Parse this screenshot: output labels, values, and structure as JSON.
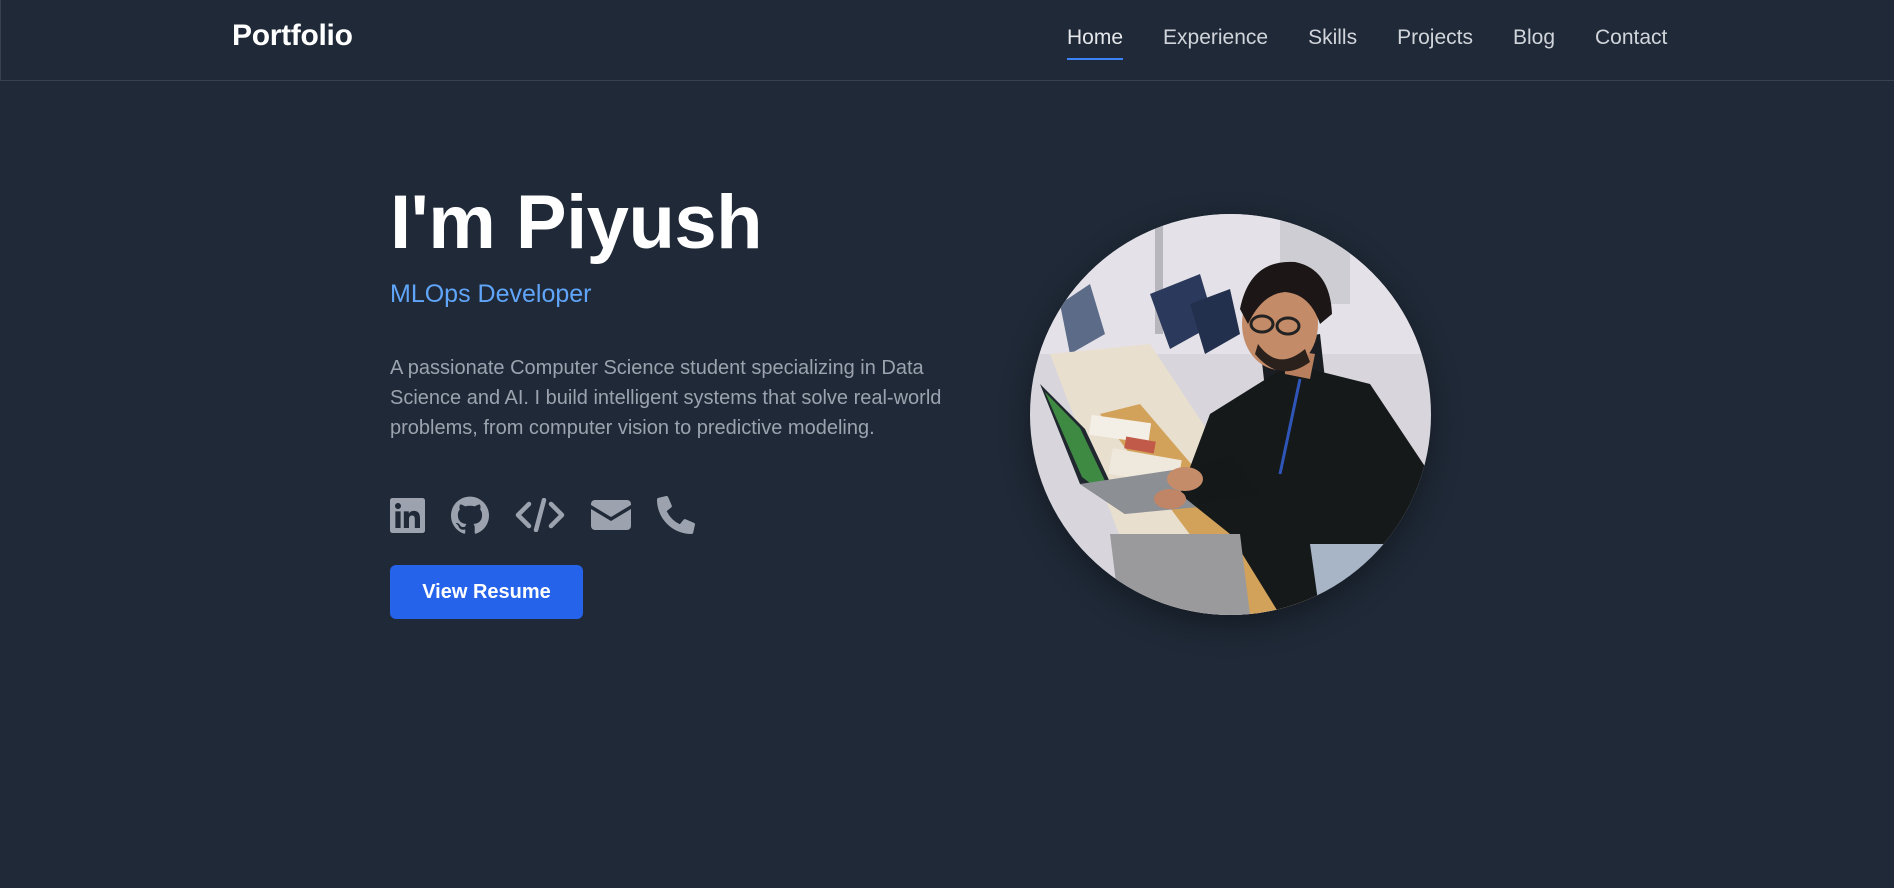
{
  "header": {
    "brand": "Portfolio",
    "nav": [
      {
        "label": "Home",
        "active": true
      },
      {
        "label": "Experience",
        "active": false
      },
      {
        "label": "Skills",
        "active": false
      },
      {
        "label": "Projects",
        "active": false
      },
      {
        "label": "Blog",
        "active": false
      },
      {
        "label": "Contact",
        "active": false
      }
    ]
  },
  "hero": {
    "title": "I'm Piyush",
    "role": "MLOps Developer",
    "description": "A passionate Computer Science student specializing in Data Science and AI. I build intelligent systems that solve real-world problems, from computer vision to predictive modeling.",
    "socials": [
      {
        "icon": "linkedin-icon"
      },
      {
        "icon": "github-icon"
      },
      {
        "icon": "code-icon"
      },
      {
        "icon": "envelope-icon"
      },
      {
        "icon": "phone-icon"
      }
    ],
    "resume_label": "View Resume"
  },
  "colors": {
    "background": "#1f2937",
    "accent": "#2563eb",
    "role_text": "#60a5fa",
    "icon": "#9ca3af"
  }
}
